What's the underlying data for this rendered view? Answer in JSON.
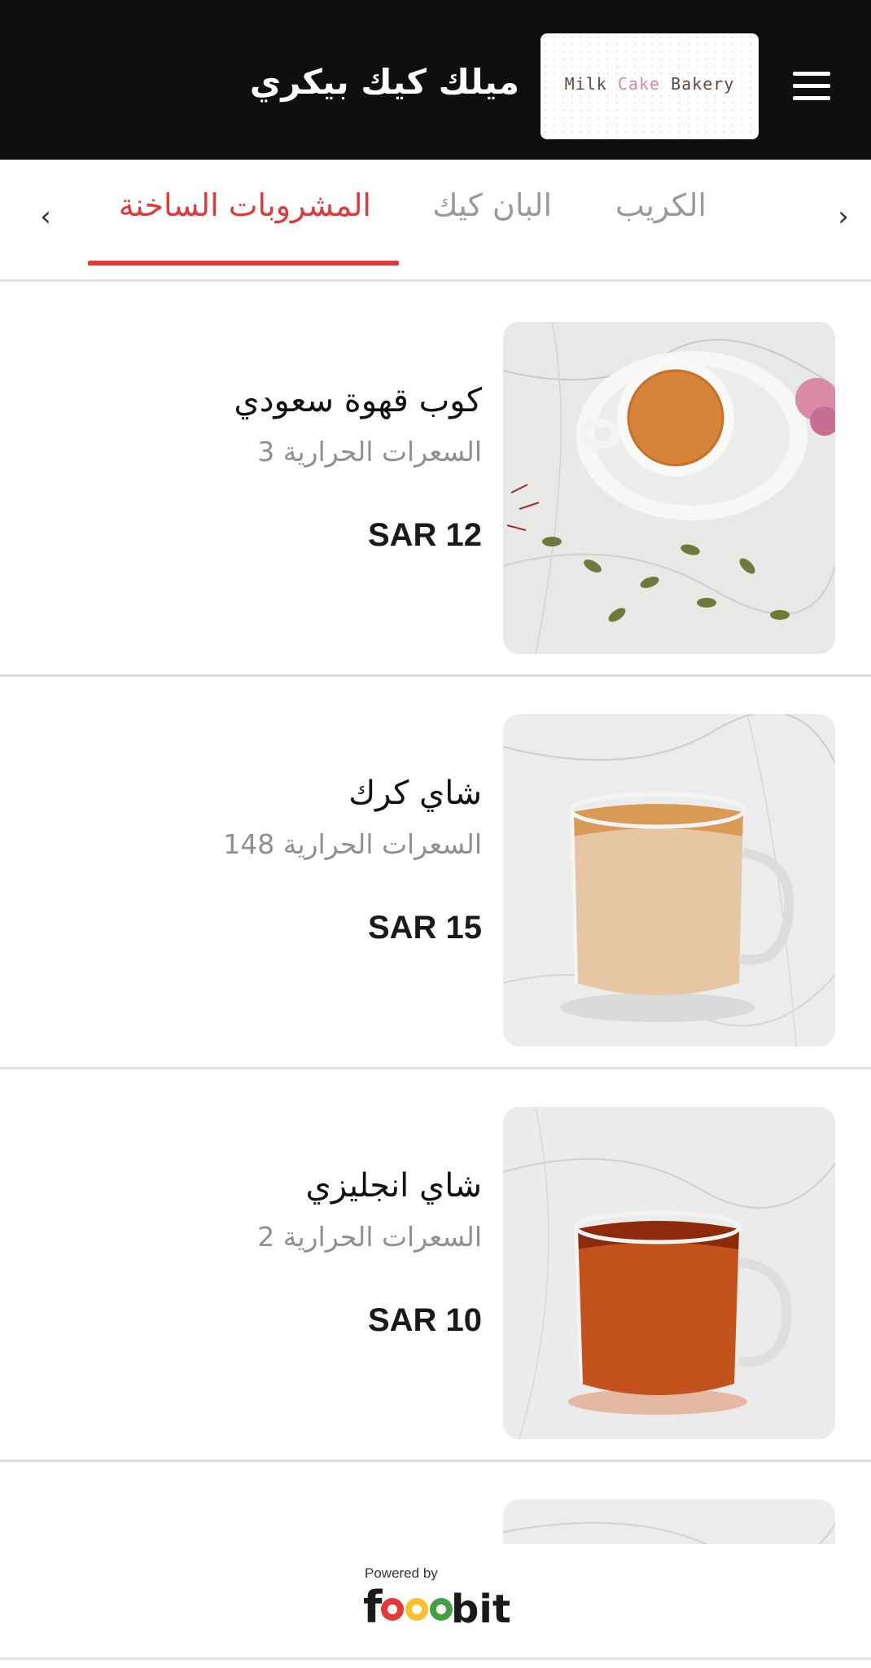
{
  "header": {
    "store_name": "ميلك كيك بيكري",
    "logo_text_1": "Milk",
    "logo_text_2": "Cake",
    "logo_text_3": "Bakery"
  },
  "tabs": {
    "items": [
      {
        "label": "الكريب",
        "active": false
      },
      {
        "label": "البان كيك",
        "active": false
      },
      {
        "label": "المشروبات الساخنة",
        "active": true
      }
    ],
    "prev_icon": "chevron-left-icon",
    "next_icon": "chevron-right-icon",
    "active_color": "#e0393a"
  },
  "items": [
    {
      "name": "كوب قهوة سعودي",
      "calories": "السعرات الحرارية 3",
      "price": "SAR 12",
      "image": "saudi-coffee-cup"
    },
    {
      "name": "شاي كرك",
      "calories": "السعرات الحرارية 148",
      "price": "SAR 15",
      "image": "karak-tea-mug"
    },
    {
      "name": "شاي انجليزي",
      "calories": "السعرات الحرارية 2",
      "price": "SAR 10",
      "image": "english-tea-mug"
    }
  ],
  "footer": {
    "powered_by": "Powered by",
    "brand": "foodbit"
  }
}
